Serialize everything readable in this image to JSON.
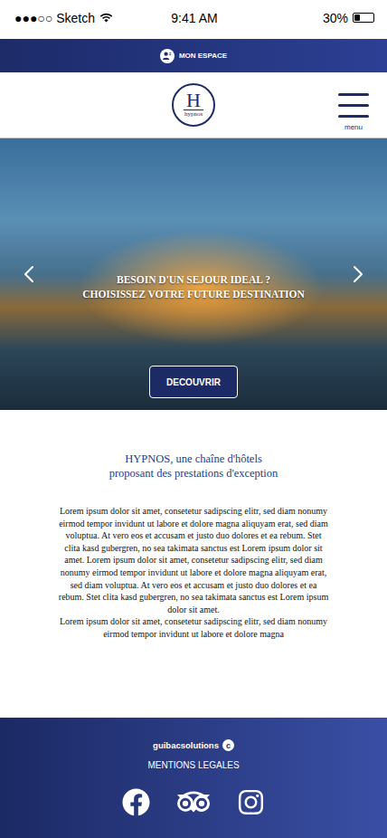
{
  "status_bar": {
    "carrier": "●●●○○ Sketch",
    "time": "9:41 AM",
    "battery": "30%",
    "level": 0.3
  },
  "top_bar": {
    "label": "MON ESPACE"
  },
  "header": {
    "logo_letter": "H",
    "logo_name": "hypnos",
    "menu_label": "menu"
  },
  "hero": {
    "lines": [
      "BESOIN D'UN SEJOUR IDEAL ?",
      "CHOISISSEZ VOTRE FUTURE DESTINATION"
    ],
    "button": "DECOUVRIR"
  },
  "intro": {
    "title_lines": [
      "HYPNOS, une chaîne d'hôtels",
      "proposant des prestations d'exception"
    ],
    "paragraphs": [
      "Lorem ipsum dolor sit amet, consetetur sadipscing elitr, sed diam nonumy eirmod tempor invidunt ut labore et dolore magna aliquyam erat, sed diam voluptua. At vero eos et accusam et justo duo dolores et ea rebum. Stet clita kasd gubergren, no sea takimata sanctus est Lorem ipsum dolor sit amet. Lorem ipsum dolor sit amet, consetetur sadipscing elitr, sed diam nonumy eirmod tempor invidunt ut labore et dolore magna aliquyam erat, sed diam voluptua. At vero eos et accusam et justo duo dolores et ea rebum. Stet clita kasd gubergren, no sea takimata sanctus est Lorem ipsum dolor sit amet.",
      "Lorem ipsum dolor sit amet, consetetur sadipscing elitr, sed diam nonumy eirmod tempor invidunt ut labore et dolore magna"
    ]
  },
  "footer": {
    "brand": "guibacsolutions",
    "brand_mark": "c",
    "legal": "MENTIONS LEGALES"
  }
}
